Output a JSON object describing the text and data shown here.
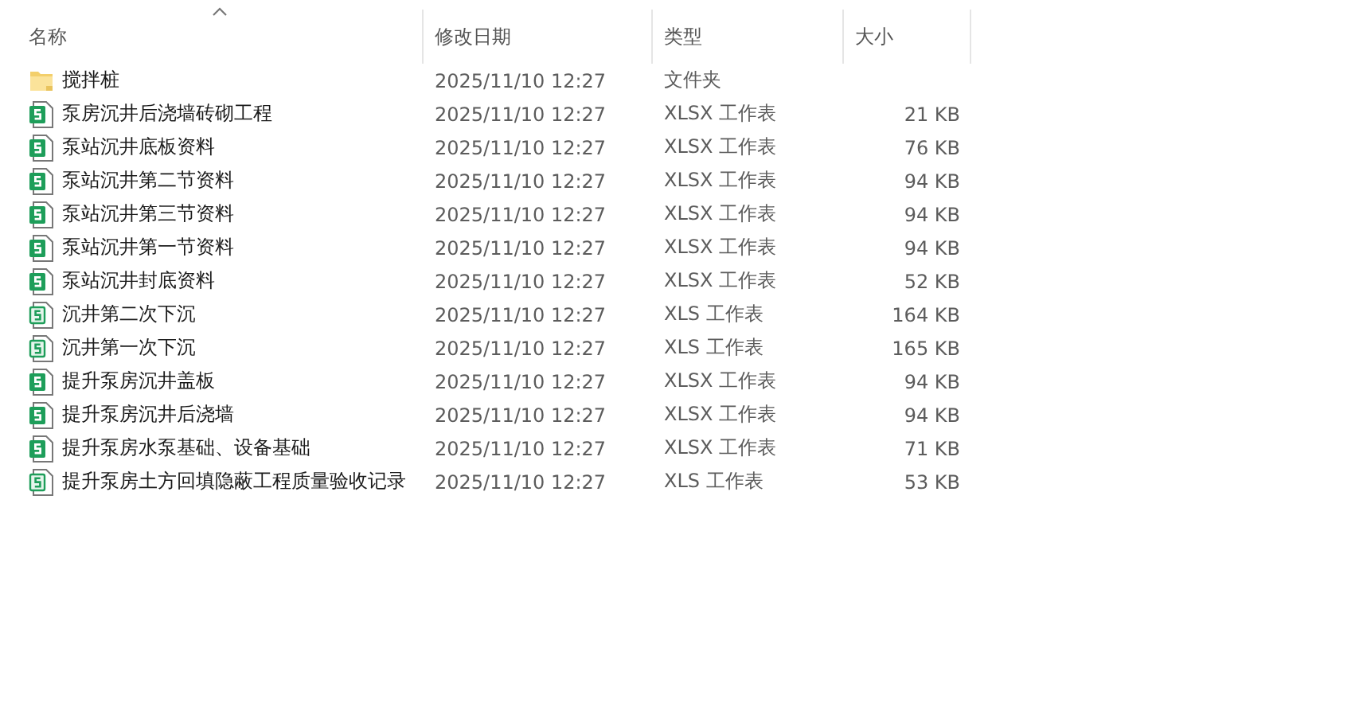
{
  "columns": [
    {
      "label": "名称",
      "sorted": true
    },
    {
      "label": "修改日期",
      "sorted": false
    },
    {
      "label": "类型",
      "sorted": false
    },
    {
      "label": "大小",
      "sorted": false
    }
  ],
  "files": [
    {
      "kind": "folder",
      "name": "搅拌桩",
      "modified": "2025/11/10 12:27",
      "type": "文件夹"
    },
    {
      "kind": "xlsx",
      "name": "泵房沉井后浇墙砖砌工程",
      "modified": "2025/11/10 12:27",
      "type": "XLSX 工作表",
      "size": "21 KB"
    },
    {
      "kind": "xlsx",
      "name": "泵站沉井底板资料",
      "modified": "2025/11/10 12:27",
      "type": "XLSX 工作表",
      "size": "76 KB"
    },
    {
      "kind": "xlsx",
      "name": "泵站沉井第二节资料",
      "modified": "2025/11/10 12:27",
      "type": "XLSX 工作表",
      "size": "94 KB"
    },
    {
      "kind": "xlsx",
      "name": "泵站沉井第三节资料",
      "modified": "2025/11/10 12:27",
      "type": "XLSX 工作表",
      "size": "94 KB"
    },
    {
      "kind": "xlsx",
      "name": "泵站沉井第一节资料",
      "modified": "2025/11/10 12:27",
      "type": "XLSX 工作表",
      "size": "94 KB"
    },
    {
      "kind": "xlsx",
      "name": "泵站沉井封底资料",
      "modified": "2025/11/10 12:27",
      "type": "XLSX 工作表",
      "size": "52 KB"
    },
    {
      "kind": "xls",
      "name": "沉井第二次下沉",
      "modified": "2025/11/10 12:27",
      "type": "XLS 工作表",
      "size": "164 KB"
    },
    {
      "kind": "xls",
      "name": "沉井第一次下沉",
      "modified": "2025/11/10 12:27",
      "type": "XLS 工作表",
      "size": "165 KB"
    },
    {
      "kind": "xlsx",
      "name": "提升泵房沉井盖板",
      "modified": "2025/11/10 12:27",
      "type": "XLSX 工作表",
      "size": "94 KB"
    },
    {
      "kind": "xlsx",
      "name": "提升泵房沉井后浇墙",
      "modified": "2025/11/10 12:27",
      "type": "XLSX 工作表",
      "size": "94 KB"
    },
    {
      "kind": "xlsx",
      "name": "提升泵房水泵基础、设备基础",
      "modified": "2025/11/10 12:27",
      "type": "XLSX 工作表",
      "size": "71 KB"
    },
    {
      "kind": "xls",
      "name": "提升泵房土方回填隐蔽工程质量验收记录",
      "modified": "2025/11/10 12:27",
      "type": "XLS 工作表",
      "size": "53 KB"
    }
  ]
}
